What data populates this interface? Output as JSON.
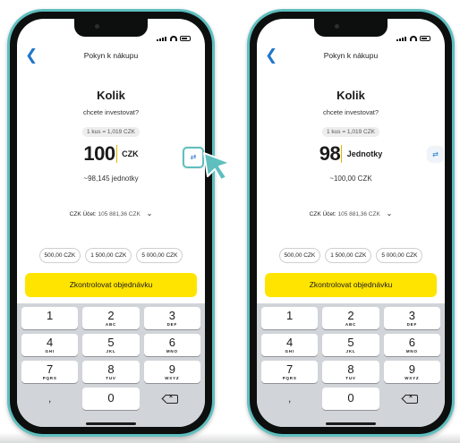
{
  "colors": {
    "accent_teal": "#5fbfbf",
    "cta_yellow": "#ffe400",
    "link_blue": "#2276c9",
    "keypad_bg": "#d1d4d8"
  },
  "phones": [
    {
      "nav_title": "Pokyn k nákupu",
      "title": "Kolik",
      "subtitle": "chcete investovat?",
      "rate": "1 kus = 1,019 CZK",
      "amount": "100",
      "unit": "CZK",
      "approx": "~98,145 jednotky",
      "account_label": "CZK Účet:",
      "account_balance": "105 881,36 CZK",
      "chips": [
        "500,00 CZK",
        "1 500,00 CZK",
        "5 000,00 CZK"
      ],
      "cta": "Zkontrolovat objednávku",
      "swap_highlighted": true
    },
    {
      "nav_title": "Pokyn k nákupu",
      "title": "Kolik",
      "subtitle": "chcete investovat?",
      "rate": "1 kus = 1,019 CZK",
      "amount": "98",
      "unit": "Jednotky",
      "approx": "~100,00 CZK",
      "account_label": "CZK Účet:",
      "account_balance": "105 881,36 CZK",
      "chips": [
        "500,00 CZK",
        "1 500,00 CZK",
        "5 000,00 CZK"
      ],
      "cta": "Zkontrolovat objednávku",
      "swap_highlighted": false
    }
  ],
  "keypad": [
    [
      {
        "n": "1",
        "l": ""
      },
      {
        "n": "2",
        "l": "ABC"
      },
      {
        "n": "3",
        "l": "DEF"
      }
    ],
    [
      {
        "n": "4",
        "l": "GHI"
      },
      {
        "n": "5",
        "l": "JKL"
      },
      {
        "n": "6",
        "l": "MNO"
      }
    ],
    [
      {
        "n": "7",
        "l": "PQRS"
      },
      {
        "n": "8",
        "l": "TUV"
      },
      {
        "n": "9",
        "l": "WXYZ"
      }
    ]
  ],
  "keypad_bottom": {
    "left": ",",
    "zero": "0",
    "delete_icon": "backspace-icon"
  },
  "icons": {
    "back": "chevron-left-icon",
    "swap": "swap-arrows-icon",
    "dropdown": "chevron-down-icon",
    "pointer": "cursor-pointer-icon"
  }
}
